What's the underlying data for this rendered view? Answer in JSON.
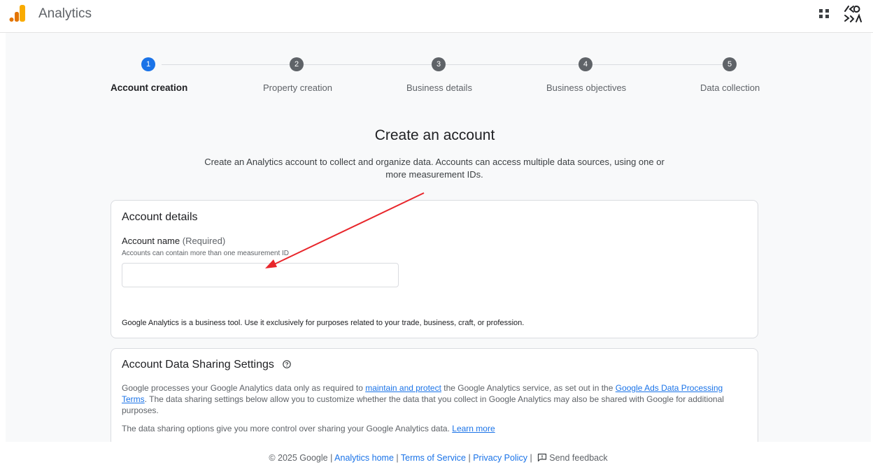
{
  "header": {
    "app_title": "Analytics",
    "logo_icon": "analytics-logo-icon",
    "apps_icon": "apps-grid-icon",
    "account_icon": "account-avatar-icon"
  },
  "stepper": {
    "steps": [
      {
        "number": "1",
        "label": "Account creation",
        "active": true
      },
      {
        "number": "2",
        "label": "Property creation",
        "active": false
      },
      {
        "number": "3",
        "label": "Business details",
        "active": false
      },
      {
        "number": "4",
        "label": "Business objectives",
        "active": false
      },
      {
        "number": "5",
        "label": "Data collection",
        "active": false
      }
    ]
  },
  "page": {
    "title": "Create an account",
    "description": "Create an Analytics account to collect and organize data. Accounts can access multiple data sources, using one or more measurement IDs."
  },
  "account_details": {
    "title": "Account details",
    "field_label": "Account name",
    "field_required": "(Required)",
    "field_help": "Accounts can contain more than one measurement ID",
    "field_value": "",
    "business_note": "Google Analytics is a business tool. Use it exclusively for purposes related to your trade, business, craft, or profession."
  },
  "data_sharing": {
    "title": "Account Data Sharing Settings",
    "help_icon": "help-circle-icon",
    "text_part1": "Google processes your Google Analytics data only as required to ",
    "link1": "maintain and protect",
    "text_part2": " the Google Analytics service, as set out in the ",
    "link2": "Google Ads Data Processing Terms",
    "text_part3": ". The data sharing settings below allow you to customize whether the data that you collect in Google Analytics may also be shared with Google for additional purposes.",
    "text_line2": "The data sharing options give you more control over sharing your Google Analytics data. ",
    "learn_more": "Learn more"
  },
  "footer": {
    "copyright": "© 2025 Google",
    "analytics_home": "Analytics home",
    "terms": "Terms of Service",
    "privacy": "Privacy Policy",
    "feedback": "Send feedback",
    "separator": "|"
  },
  "colors": {
    "accent": "#1a73e8",
    "annotation_arrow": "#e8262b",
    "logo_orange": "#f9ab00",
    "logo_dark_orange": "#e37400"
  }
}
